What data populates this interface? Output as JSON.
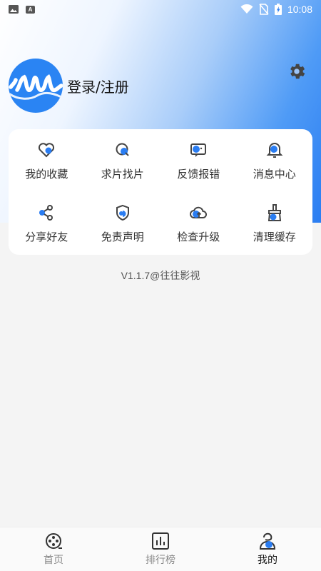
{
  "status_bar": {
    "time": "10:08",
    "left_icons": [
      "image-notification-icon",
      "a-notification-icon"
    ],
    "right_icons": [
      "wifi-icon",
      "no-sim-icon",
      "battery-charging-icon"
    ]
  },
  "profile": {
    "login_label": "登录/注册",
    "avatar_icon": "wave-logo-icon"
  },
  "settings_icon": "gear-icon",
  "menu": [
    {
      "label": "我的收藏",
      "icon": "heart-icon"
    },
    {
      "label": "求片找片",
      "icon": "search-film-icon"
    },
    {
      "label": "反馈报错",
      "icon": "feedback-icon"
    },
    {
      "label": "消息中心",
      "icon": "bell-icon"
    },
    {
      "label": "分享好友",
      "icon": "share-icon"
    },
    {
      "label": "免责声明",
      "icon": "shield-icon"
    },
    {
      "label": "检查升级",
      "icon": "cloud-upload-icon"
    },
    {
      "label": "清理缓存",
      "icon": "broom-icon"
    }
  ],
  "version": "V1.1.7@往往影视",
  "tabs": [
    {
      "label": "首页",
      "icon": "film-reel-icon",
      "active": false
    },
    {
      "label": "排行榜",
      "icon": "bar-chart-icon",
      "active": false
    },
    {
      "label": "我的",
      "icon": "profile-icon",
      "active": true
    }
  ],
  "colors": {
    "accent": "#2a7df2",
    "icon_outline": "#444444",
    "card_bg": "#ffffff",
    "page_bg": "#f4f4f4"
  }
}
